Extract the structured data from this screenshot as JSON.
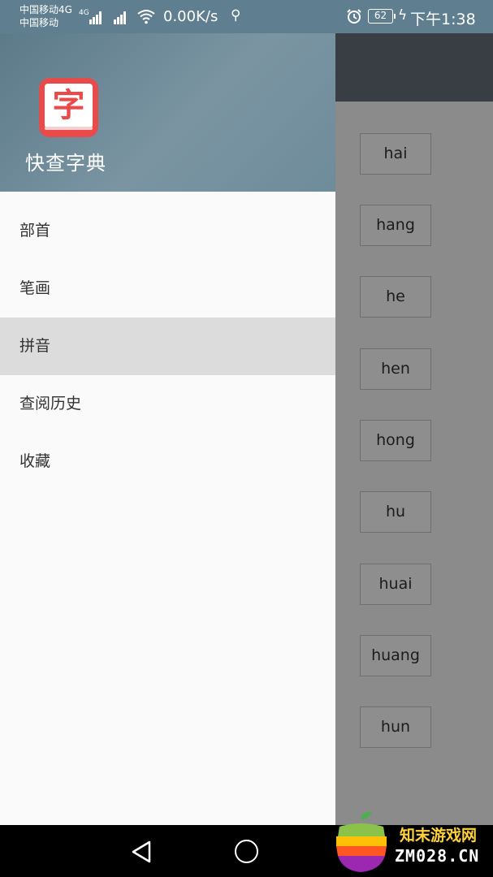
{
  "status_bar": {
    "carrier1": "中国移动4G",
    "carrier1_net": "4G",
    "carrier2": "中国移动",
    "net_speed": "0.00K/s",
    "battery": "62",
    "time": "下午1:38"
  },
  "drawer": {
    "app_icon_char": "字",
    "app_name": "快查字典",
    "items": [
      {
        "label": "部首",
        "selected": false
      },
      {
        "label": "笔画",
        "selected": false
      },
      {
        "label": "拼音",
        "selected": true
      },
      {
        "label": "查阅历史",
        "selected": false
      },
      {
        "label": "收藏",
        "selected": false
      }
    ]
  },
  "content": {
    "pinyin_buttons": [
      "hai",
      "hang",
      "he",
      "hen",
      "hong",
      "hu",
      "huai",
      "huang",
      "hun"
    ]
  },
  "watermark": {
    "line1": "知末游戏网",
    "line2": "ZM028.CN"
  },
  "colors": {
    "header": "#6b8796",
    "accent_red": "#e94b4b",
    "selected_item": "#dcdcdc",
    "scrim_content": "#8b8b8b"
  }
}
